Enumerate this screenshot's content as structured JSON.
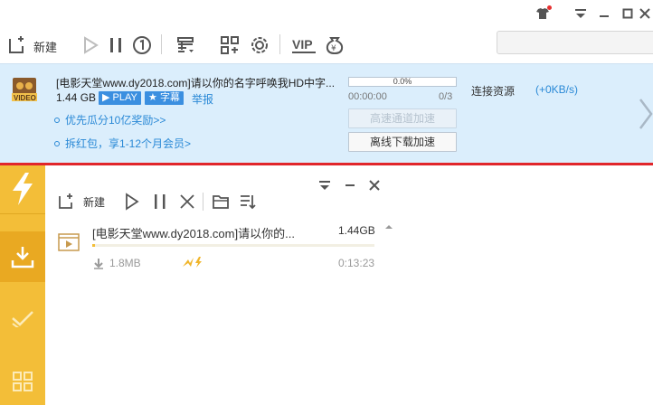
{
  "toolbar": {
    "new_label": "新建"
  },
  "task": {
    "title": "[电影天堂www.dy2018.com]请以你的名字呼唤我HD中字...",
    "size": "1.44 GB",
    "play_tag": "PLAY",
    "subtitle_tag": "字幕",
    "report_label": "举报",
    "progress_percent": "0.0%",
    "progress_fraction": 0.0,
    "elapsed": "00:00:00",
    "count": "0/3",
    "status": "连接资源",
    "speed": "(+0KB/s)",
    "promo1": "优先瓜分10亿奖励>>",
    "promo2": "拆红包，享1-12个月会员>",
    "fast_button": "高速通道加速",
    "offline_button": "离线下载加速",
    "video_badge": "VIDEO"
  },
  "float_panel": {
    "new_label": "新建",
    "item": {
      "title": "[电影天堂www.dy2018.com]请以你的...",
      "size": "1.44GB",
      "downloaded": "1.8MB",
      "time": "0:13:23",
      "progress_fraction": 0.01
    }
  },
  "colors": {
    "accent_blue": "#2a89d6",
    "banner_bg": "#dbeefc",
    "red_line": "#e1262b",
    "sidebar_yellow": "#f3be38"
  }
}
